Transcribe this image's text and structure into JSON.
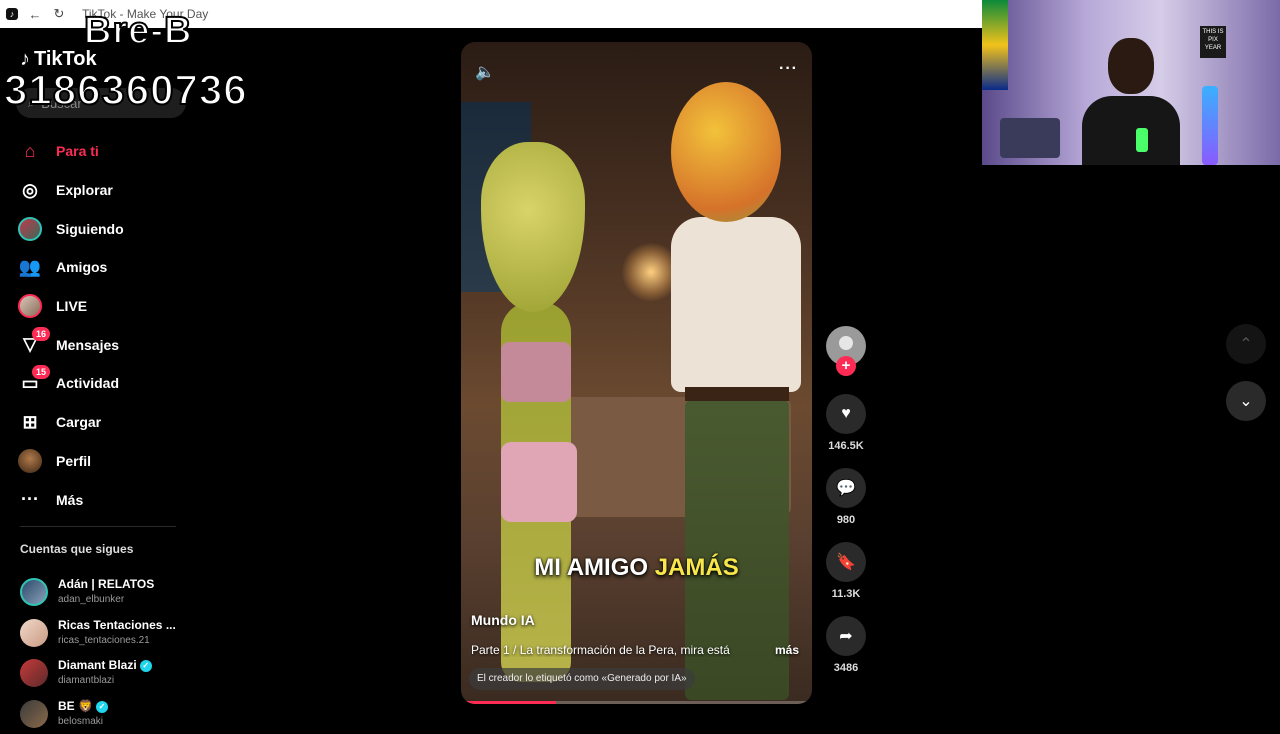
{
  "browser": {
    "tab_title": "TikTok - Make Your Day"
  },
  "overlay": {
    "name": "Bre-B",
    "number": "3186360736"
  },
  "tiktok": {
    "logo_text": "TikTok",
    "search_placeholder": "Buscar"
  },
  "nav": [
    {
      "label": "Para ti",
      "icon": "home-icon",
      "active": true
    },
    {
      "label": "Explorar",
      "icon": "compass-icon"
    },
    {
      "label": "Siguiendo",
      "icon": "following-avatar"
    },
    {
      "label": "Amigos",
      "icon": "friends-icon"
    },
    {
      "label": "LIVE",
      "icon": "live-avatar"
    },
    {
      "label": "Mensajes",
      "icon": "messages-icon",
      "badge": "16"
    },
    {
      "label": "Actividad",
      "icon": "activity-icon",
      "badge": "15"
    },
    {
      "label": "Cargar",
      "icon": "upload-icon"
    },
    {
      "label": "Perfil",
      "icon": "profile-avatar"
    },
    {
      "label": "Más",
      "icon": "more-icon"
    }
  ],
  "following": {
    "title": "Cuentas que sigues",
    "accounts": [
      {
        "name": "Adán | RELATOS",
        "handle": "adan_elbunker",
        "verified": false
      },
      {
        "name": "Ricas Tentaciones ...",
        "handle": "ricas_tentaciones.21",
        "verified": false
      },
      {
        "name": "Diamant Blazi",
        "handle": "diamantblazi",
        "verified": true
      },
      {
        "name": "BE 🦁",
        "handle": "belosmaki",
        "verified": true
      }
    ]
  },
  "video": {
    "caption_part1": "MI AMIGO",
    "caption_highlight": "JAMÁS",
    "author": "Mundo IA",
    "description": "Parte 1 / La transformación de la Pera, mira está",
    "more_link": "más",
    "ai_label": "El creador lo etiquetó como «Generado por IA»",
    "progress_fraction": 0.27
  },
  "actions": {
    "likes": "146.5K",
    "comments": "980",
    "saves": "11.3K",
    "shares": "3486"
  },
  "webcam": {
    "poster_text": "THIS IS PIX YEAR"
  },
  "colors": {
    "accent": "#fe2c55",
    "verified": "#20d5ec",
    "caption_highlight": "#f8e64a"
  }
}
